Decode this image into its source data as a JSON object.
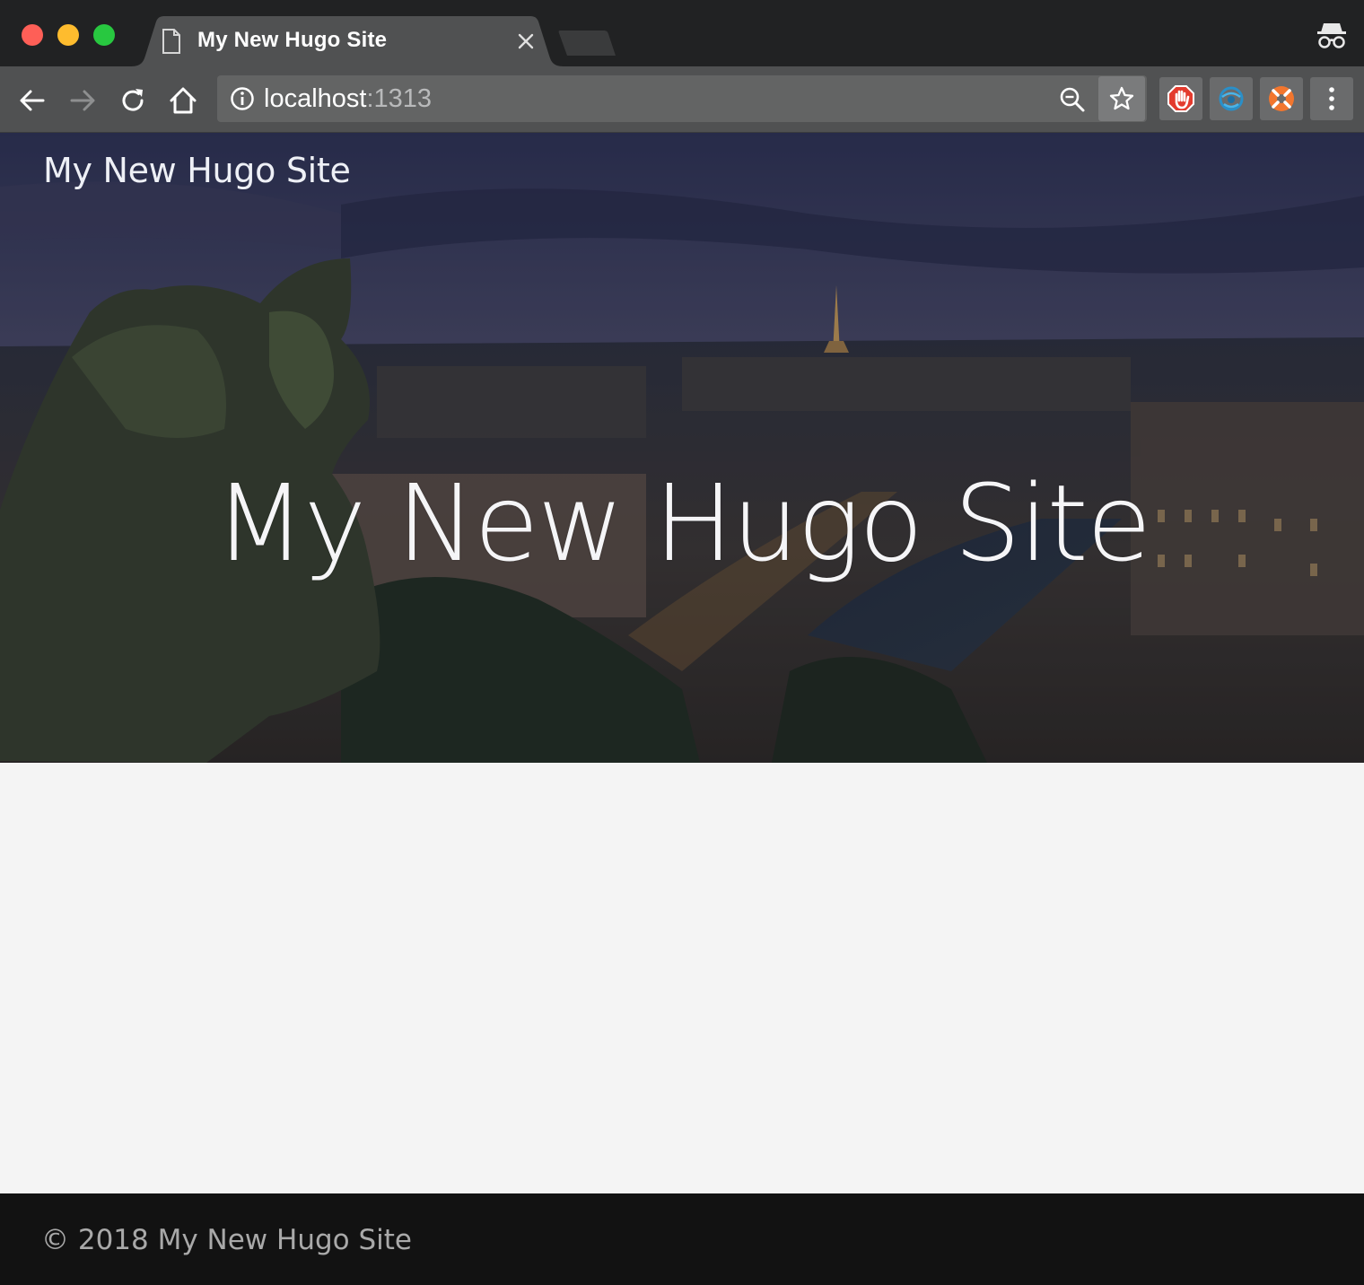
{
  "browser": {
    "tab_title": "My New Hugo Site",
    "url_host": "localhost",
    "url_port": ":1313"
  },
  "site": {
    "brand": "My New Hugo Site",
    "hero_title": "My New Hugo Site",
    "footer_text": "© 2018 My New Hugo Site"
  },
  "icons": {
    "tab": "document-icon",
    "close": "close-icon",
    "back": "back-arrow-icon",
    "forward": "forward-arrow-icon",
    "reload": "reload-icon",
    "home": "home-icon",
    "info": "info-icon",
    "zoom": "zoom-out-icon",
    "bookmark": "star-icon",
    "extensions": [
      "adblock-hand-icon",
      "globe-extension-icon",
      "orange-lifebuoy-icon"
    ],
    "menu": "more-vert-icon",
    "incognito": "incognito-icon"
  },
  "colors": {
    "close_red": "#fe5f57",
    "minimize_yellow": "#febc2e",
    "zoom_green": "#28c840",
    "footer_bg": "#121212",
    "page_bg": "#f4f4f4"
  }
}
